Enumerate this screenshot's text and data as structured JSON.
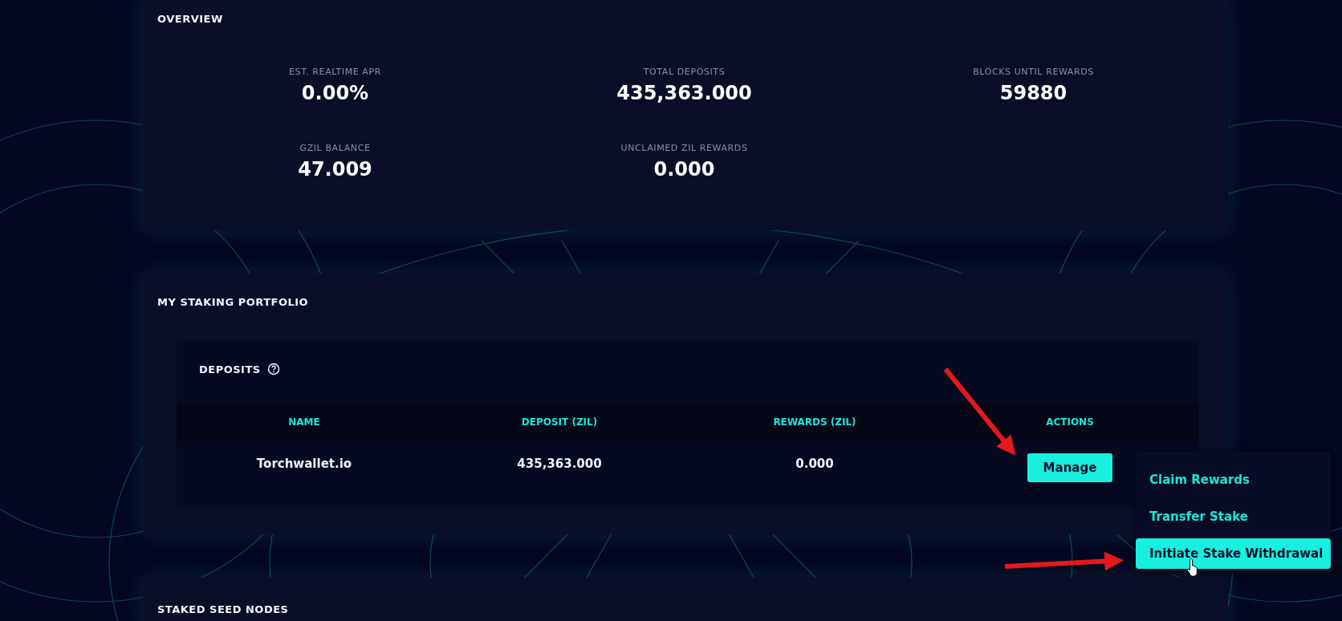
{
  "overview": {
    "title": "OVERVIEW",
    "stats": [
      {
        "label": "EST. REALTIME APR",
        "value": "0.00%"
      },
      {
        "label": "TOTAL DEPOSITS",
        "value": "435,363.000"
      },
      {
        "label": "BLOCKS UNTIL REWARDS",
        "value": "59880"
      },
      {
        "label": "GZIL BALANCE",
        "value": "47.009"
      },
      {
        "label": "UNCLAIMED ZIL REWARDS",
        "value": "0.000"
      }
    ]
  },
  "portfolio": {
    "title": "MY STAKING PORTFOLIO",
    "deposits": {
      "title": "DEPOSITS",
      "columns": [
        "NAME",
        "DEPOSIT (ZIL)",
        "REWARDS (ZIL)",
        "ACTIONS"
      ],
      "rows": [
        {
          "name": "Torchwallet.io",
          "deposit": "435,363.000",
          "rewards": "0.000",
          "action": "Manage"
        }
      ]
    },
    "menu": [
      {
        "label": "Claim Rewards",
        "selected": false
      },
      {
        "label": "Transfer Stake",
        "selected": false
      },
      {
        "label": "Initiate Stake Withdrawal",
        "selected": true
      }
    ]
  },
  "staked_seed_nodes": {
    "title": "STAKED SEED NODES"
  }
}
